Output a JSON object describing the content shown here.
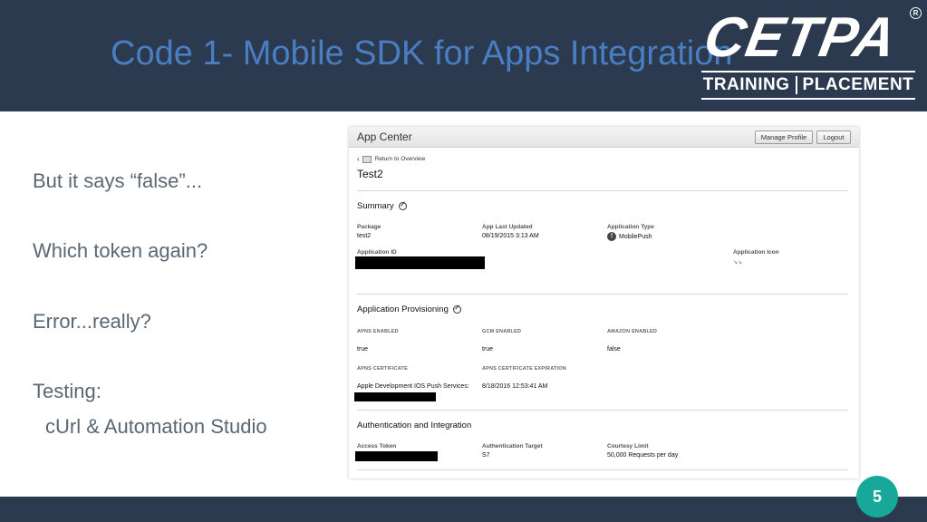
{
  "slide": {
    "title": "Code 1- Mobile SDK for Apps Integration",
    "page_number": "5"
  },
  "logo": {
    "word": "CETPA",
    "reg": "R",
    "tag_left": "TRAINING",
    "tag_right": "PLACEMENT"
  },
  "bullets": [
    "But it says “false”...",
    "Which token again?",
    "Error...really?",
    "Testing:",
    "cUrl & Automation Studio"
  ],
  "app": {
    "header_title": "App Center",
    "manage_profile_label": "Manage Profile",
    "logout_label": "Logout",
    "back_label": "Return to Overview",
    "app_name": "Test2",
    "summary": {
      "title": "Summary",
      "package_label": "Package",
      "package_value": "test2",
      "last_updated_label": "App Last Updated",
      "last_updated_value": "08/19/2015 3:13 AM",
      "app_type_label": "Application Type",
      "app_type_value": "MobilePush",
      "app_id_label": "Application ID",
      "app_icon_label": "Application Icon"
    },
    "provisioning": {
      "title": "Application Provisioning",
      "apns_label": "APNS ENABLED",
      "apns_value": "true",
      "gcm_label": "GCM ENABLED",
      "gcm_value": "true",
      "amazon_label": "AMAZON ENABLED",
      "amazon_value": "false",
      "cert_label": "APNS CERTIFICATE",
      "cert_value": "Apple Development IOS Push Services:",
      "cert_exp_label": "APNS CERTIFICATE EXPIRATION",
      "cert_exp_value": "8/18/2016 12:53:41 AM"
    },
    "auth": {
      "title": "Authentication and Integration",
      "token_label": "Access Token",
      "target_label": "Authentication Target",
      "target_value": "S7",
      "limit_label": "Courtesy Limit",
      "limit_value": "50,000 Requests per day"
    }
  },
  "colors": {
    "header_bg": "#2b3a4e",
    "title_blue": "#4a7ec2",
    "bullet_gray": "#5a6775",
    "page_badge": "#17a89a"
  }
}
